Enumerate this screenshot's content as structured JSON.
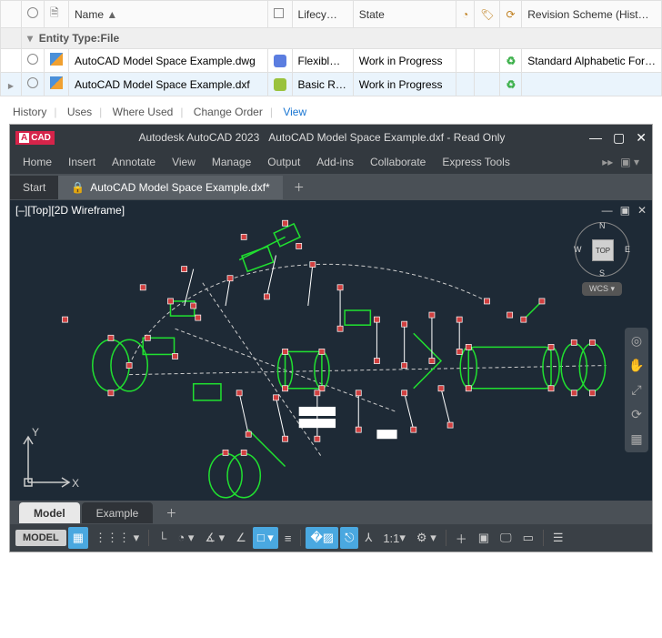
{
  "grid": {
    "headers": {
      "name": "Name",
      "lifecycle": "Lifecy…",
      "state": "State",
      "revision": "Revision Scheme (Hist…"
    },
    "group_label": "Entity Type:File",
    "rows": [
      {
        "name": "AutoCAD Model Space Example.dwg",
        "lifecycle": "Flexibl…",
        "lifecycle_color": "#5b7de0",
        "state": "Work in Progress",
        "revision": "Standard Alphabetic For…",
        "selected": false,
        "marker": ""
      },
      {
        "name": "AutoCAD Model Space Example.dxf",
        "lifecycle": "Basic R…",
        "lifecycle_color": "#9ac23c",
        "state": "Work in Progress",
        "revision": "",
        "selected": true,
        "marker": "▶"
      }
    ]
  },
  "info_tabs": {
    "items": [
      "History",
      "Uses",
      "Where Used",
      "Change Order",
      "View"
    ],
    "active": "View"
  },
  "cad": {
    "app_badge": "CAD",
    "title_app": "Autodesk AutoCAD 2023",
    "title_doc": "AutoCAD Model Space Example.dxf - Read Only",
    "menu": [
      "Home",
      "Insert",
      "Annotate",
      "View",
      "Manage",
      "Output",
      "Add-ins",
      "Collaborate",
      "Express Tools"
    ],
    "doc_tabs": {
      "start": "Start",
      "active": "AutoCAD Model Space Example.dxf*"
    },
    "view_label": "[–][Top][2D Wireframe]",
    "navcube": {
      "top": "TOP",
      "n": "N",
      "s": "S",
      "e": "E",
      "w": "W",
      "wcs": "WCS ▾"
    },
    "ucs": {
      "x": "X",
      "y": "Y"
    },
    "model_tabs": {
      "model": "Model",
      "example": "Example"
    },
    "status": {
      "model": "MODEL",
      "scale": "1:1"
    }
  }
}
